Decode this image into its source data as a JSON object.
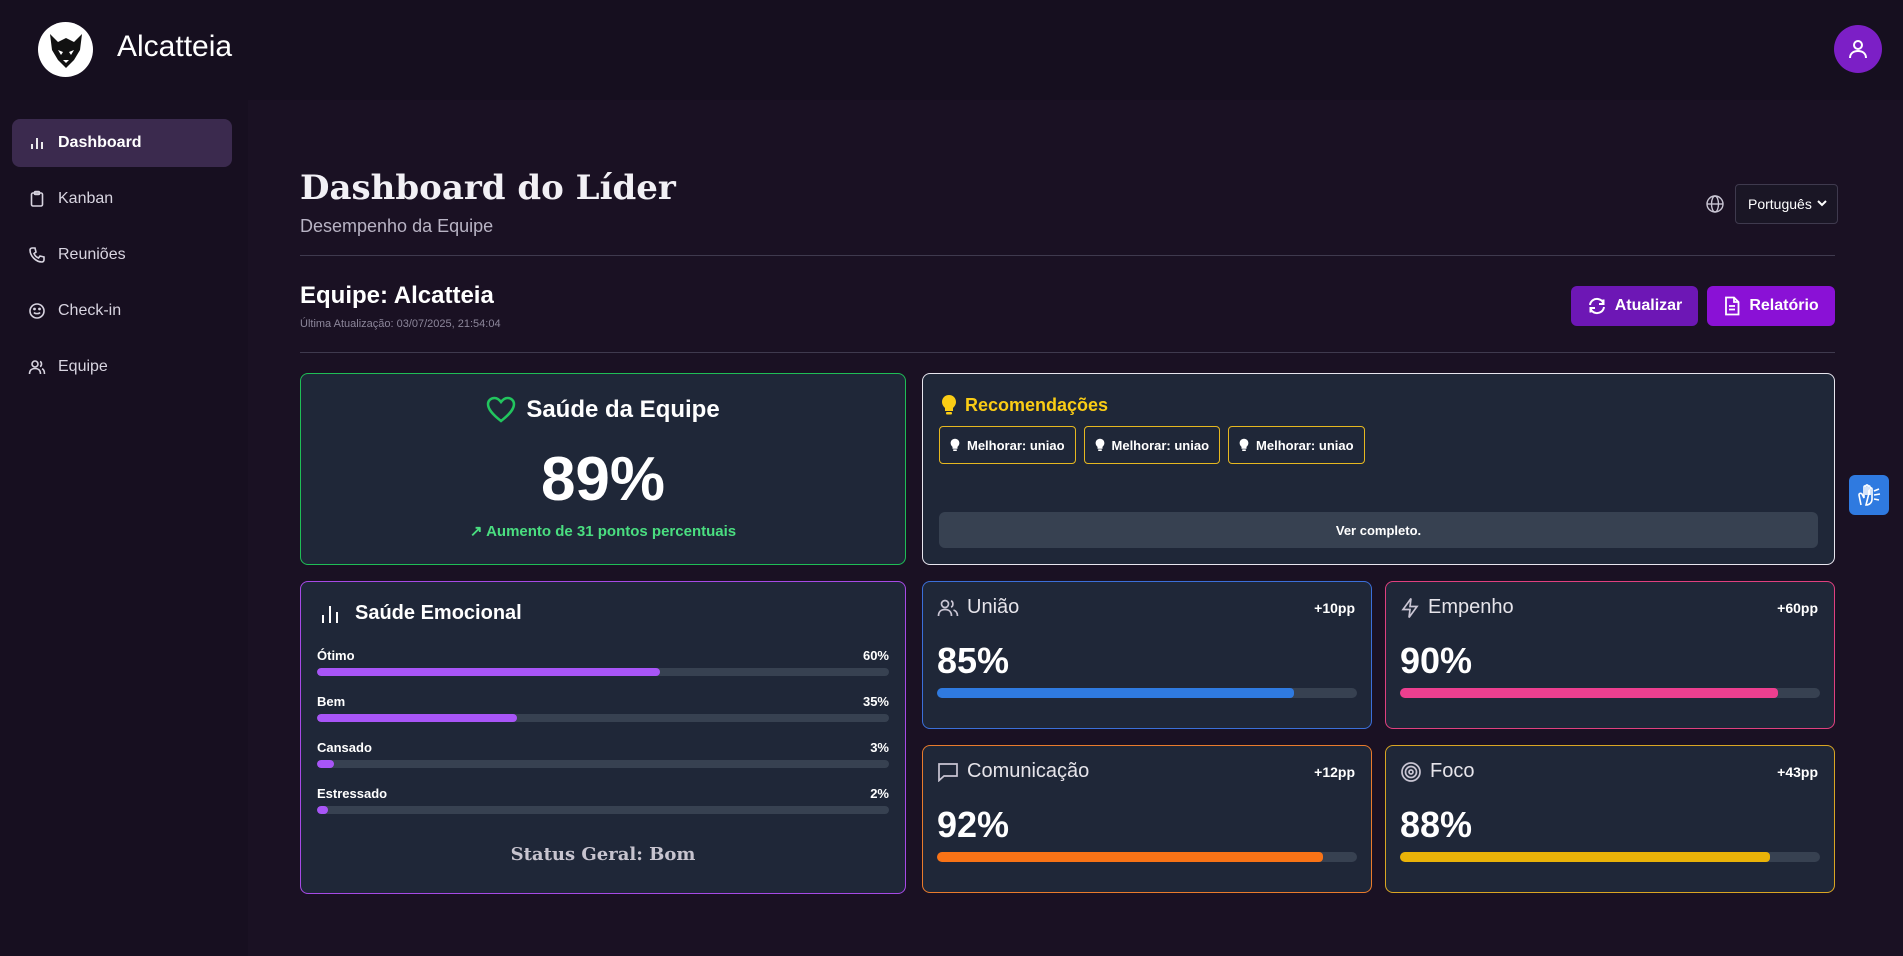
{
  "app": {
    "brand": "Alcatteia"
  },
  "sidebar": {
    "items": [
      {
        "label": "Dashboard",
        "icon": "bar-chart-icon",
        "active": true
      },
      {
        "label": "Kanban",
        "icon": "clipboard-icon",
        "active": false
      },
      {
        "label": "Reuniões",
        "icon": "phone-icon",
        "active": false
      },
      {
        "label": "Check-in",
        "icon": "smile-icon",
        "active": false
      },
      {
        "label": "Equipe",
        "icon": "users-icon",
        "active": false
      }
    ]
  },
  "header": {
    "title": "Dashboard do Líder",
    "subtitle": "Desempenho da Equipe",
    "language": "Português"
  },
  "team": {
    "title": "Equipe: Alcatteia",
    "updated": "Última Atualização: 03/07/2025, 21:54:04",
    "refresh_label": "Atualizar",
    "report_label": "Relatório"
  },
  "health": {
    "title": "Saúde da Equipe",
    "value": "89%",
    "trend": "Aumento de 31 pontos percentuais",
    "color": "#1fbe56"
  },
  "recommendations": {
    "title": "Recomendações",
    "items": [
      "Melhorar: uniao",
      "Melhorar: uniao",
      "Melhorar: uniao"
    ],
    "full_label": "Ver completo."
  },
  "emotional": {
    "title": "Saúde Emocional",
    "rows": [
      {
        "label": "Ótimo",
        "pct": "60%",
        "value": 60
      },
      {
        "label": "Bem",
        "pct": "35%",
        "value": 35
      },
      {
        "label": "Cansado",
        "pct": "3%",
        "value": 3
      },
      {
        "label": "Estressado",
        "pct": "2%",
        "value": 2
      }
    ],
    "status": "Status Geral: Bom",
    "bar_color": "#a855f7"
  },
  "metrics": [
    {
      "name": "União",
      "delta": "+10pp",
      "value": "85%",
      "level": 85,
      "color": "#2f7ae0",
      "border": "#3b6fd9",
      "icon": "users-icon"
    },
    {
      "name": "Empenho",
      "delta": "+60pp",
      "value": "90%",
      "level": 90,
      "color": "#ec3f8f",
      "border": "#e0407f",
      "icon": "lightning-icon"
    },
    {
      "name": "Comunicação",
      "delta": "+12pp",
      "value": "92%",
      "level": 92,
      "color": "#f97316",
      "border": "#e97b2c",
      "icon": "message-icon"
    },
    {
      "name": "Foco",
      "delta": "+43pp",
      "value": "88%",
      "level": 88,
      "color": "#eab308",
      "border": "#d9a623",
      "icon": "target-icon"
    }
  ]
}
